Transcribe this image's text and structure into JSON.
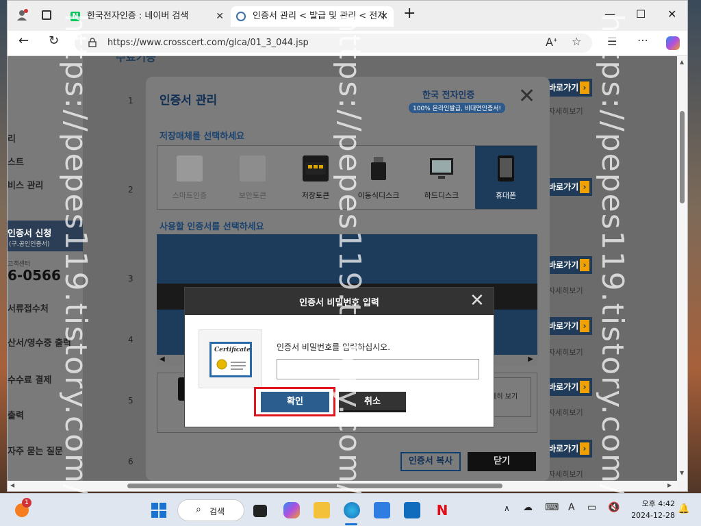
{
  "browser": {
    "tabs": [
      {
        "title": "한국전자인증 : 네이버 검색"
      },
      {
        "title": "인증서 관리 < 발급 및 관리 < 전자"
      }
    ],
    "url": "https://www.crosscert.com/glca/01_3_044.jsp"
  },
  "background_page": {
    "heading": "수료기능",
    "nav_items": [
      "리",
      "스트",
      "비스 관리",
      "서류접수처",
      "산서/영수증 출력",
      "수수료 결제",
      "출력",
      "자주 묻는 질문"
    ],
    "nav_active": {
      "title": "인증서 신청",
      "subtitle": "(구.공인인증서)"
    },
    "support_label": "고객센터",
    "phone": "6-0566",
    "row_numbers": [
      "1",
      "2",
      "3",
      "4",
      "5",
      "6"
    ],
    "go_label": "바로가기",
    "detail_label": "자세히보기"
  },
  "cert_modal": {
    "title": "인증서 관리",
    "logo_text": "한국 전자인증",
    "logo_tagline": "100% 온라인발급, 비대면인증서!",
    "section_media": "저장매체를 선택하세요",
    "media": [
      {
        "label": "스마트인증"
      },
      {
        "label": "보안토큰"
      },
      {
        "label": "저장토큰"
      },
      {
        "label": "이동식디스크"
      },
      {
        "label": "하드디스크"
      },
      {
        "label": "휴대폰"
      }
    ],
    "section_cert": "사용할 인증서를 선택하세요",
    "detail_text": "자세히 보기",
    "copy_button": "인증서 복사",
    "close_button": "닫기"
  },
  "password_dialog": {
    "title": "인증서 비밀번호 입력",
    "prompt": "인증서 비밀번호를 입력하십시오.",
    "password_value": "",
    "cert_label": "Certificate",
    "ok_button": "확인",
    "cancel_button": "취소"
  },
  "watermark": "https://pepes119.tistory.com/",
  "taskbar": {
    "search_label": "검색",
    "notification_count": "1",
    "time": "오후 4:42",
    "date": "2024-12-28"
  }
}
